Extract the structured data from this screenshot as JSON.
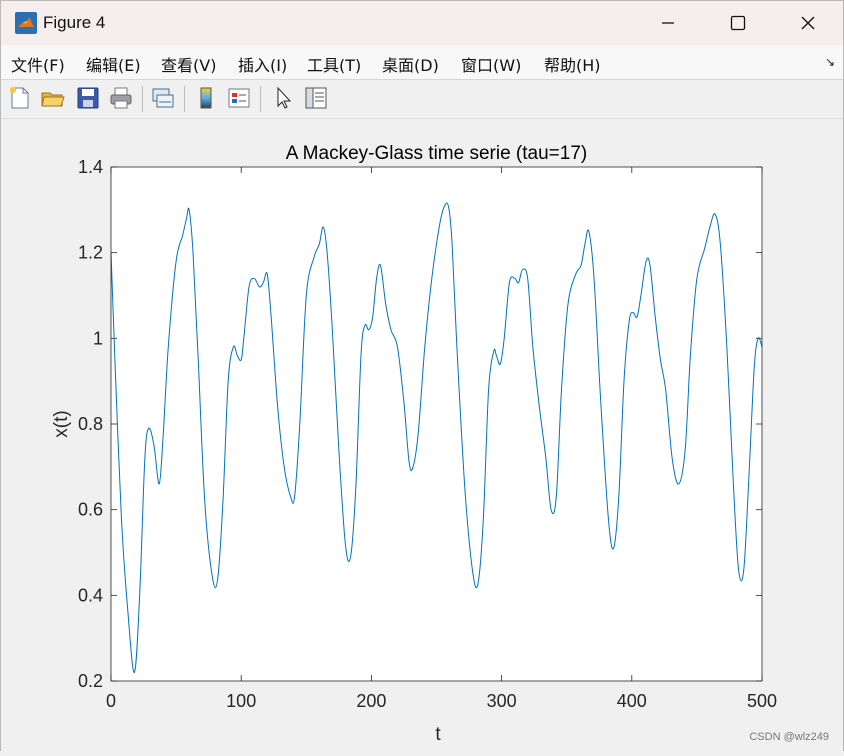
{
  "window": {
    "title": "Figure 4",
    "controls": {
      "minimize": "─",
      "maximize": "☐",
      "close": "✕"
    }
  },
  "menubar": {
    "items": [
      {
        "label": "文件(F)",
        "name": "menu-file"
      },
      {
        "label": "编辑(E)",
        "name": "menu-edit"
      },
      {
        "label": "查看(V)",
        "name": "menu-view"
      },
      {
        "label": "插入(I)",
        "name": "menu-insert"
      },
      {
        "label": "工具(T)",
        "name": "menu-tools"
      },
      {
        "label": "桌面(D)",
        "name": "menu-desktop"
      },
      {
        "label": "窗口(W)",
        "name": "menu-window"
      },
      {
        "label": "帮助(H)",
        "name": "menu-help"
      }
    ],
    "dock_arrow": "↘"
  },
  "toolbar": {
    "buttons": [
      "new-figure-icon",
      "open-file-icon",
      "save-icon",
      "print-icon",
      "link-plot-icon",
      "colorbar-icon",
      "legend-icon",
      "edit-plot-arrow-icon",
      "property-inspector-icon"
    ]
  },
  "chart_data": {
    "type": "line",
    "title": "A Mackey-Glass time serie (tau=17)",
    "xlabel": "t",
    "ylabel": "x(t)",
    "xlim": [
      0,
      500
    ],
    "ylim": [
      0.2,
      1.4
    ],
    "xticks": [
      "0",
      "100",
      "200",
      "300",
      "400",
      "500"
    ],
    "yticks": [
      "0.2",
      "0.4",
      "0.6",
      "0.8",
      "1",
      "1.2",
      "1.4"
    ],
    "grid": false,
    "series_color": "#0072bd",
    "series": [
      {
        "x": [
          0,
          3,
          8,
          13,
          18,
          22,
          26,
          29,
          33,
          37,
          40,
          44,
          50,
          55,
          58,
          60,
          63,
          67,
          72,
          78,
          82,
          86,
          90,
          94,
          97,
          100,
          102,
          106,
          110,
          114,
          117,
          120,
          123,
          128,
          133,
          138,
          141,
          145,
          150,
          156,
          160,
          163,
          166,
          170,
          175,
          180,
          184,
          188,
          192,
          195,
          198,
          201,
          204,
          207,
          211,
          215,
          220,
          225,
          229,
          232,
          236,
          241,
          246,
          251,
          255,
          259,
          262,
          266,
          272,
          278,
          282,
          286,
          290,
          294,
          296,
          299,
          302,
          306,
          310,
          313,
          316,
          320,
          324,
          329,
          334,
          338,
          342,
          346,
          351,
          357,
          361,
          364,
          367,
          371,
          376,
          382,
          386,
          390,
          394,
          398,
          401,
          404,
          407,
          411,
          414,
          418,
          422,
          426,
          431,
          436,
          441,
          445,
          450,
          456,
          460,
          464,
          468,
          473,
          478,
          482,
          486,
          490,
          494,
          497,
          500
        ],
        "y": [
          1.2,
          0.95,
          0.58,
          0.36,
          0.22,
          0.4,
          0.72,
          0.79,
          0.75,
          0.66,
          0.77,
          0.98,
          1.18,
          1.24,
          1.28,
          1.3,
          1.2,
          0.95,
          0.62,
          0.44,
          0.44,
          0.62,
          0.9,
          0.98,
          0.96,
          0.95,
          1.0,
          1.12,
          1.14,
          1.12,
          1.13,
          1.15,
          1.05,
          0.84,
          0.7,
          0.63,
          0.63,
          0.8,
          1.1,
          1.19,
          1.22,
          1.26,
          1.2,
          1.02,
          0.74,
          0.52,
          0.49,
          0.65,
          0.96,
          1.03,
          1.02,
          1.05,
          1.14,
          1.17,
          1.08,
          1.02,
          0.98,
          0.85,
          0.71,
          0.7,
          0.78,
          0.98,
          1.13,
          1.24,
          1.3,
          1.31,
          1.22,
          0.96,
          0.64,
          0.45,
          0.43,
          0.58,
          0.88,
          0.97,
          0.96,
          0.94,
          1.0,
          1.13,
          1.14,
          1.13,
          1.16,
          1.14,
          0.98,
          0.84,
          0.72,
          0.6,
          0.63,
          0.88,
          1.08,
          1.15,
          1.17,
          1.22,
          1.25,
          1.14,
          0.86,
          0.58,
          0.51,
          0.63,
          0.9,
          1.04,
          1.06,
          1.05,
          1.1,
          1.18,
          1.17,
          1.05,
          0.95,
          0.88,
          0.72,
          0.66,
          0.74,
          0.96,
          1.14,
          1.21,
          1.26,
          1.29,
          1.22,
          0.98,
          0.66,
          0.46,
          0.46,
          0.68,
          0.93,
          1.0,
          0.98
        ]
      }
    ]
  },
  "watermark": "CSDN @wlz249"
}
